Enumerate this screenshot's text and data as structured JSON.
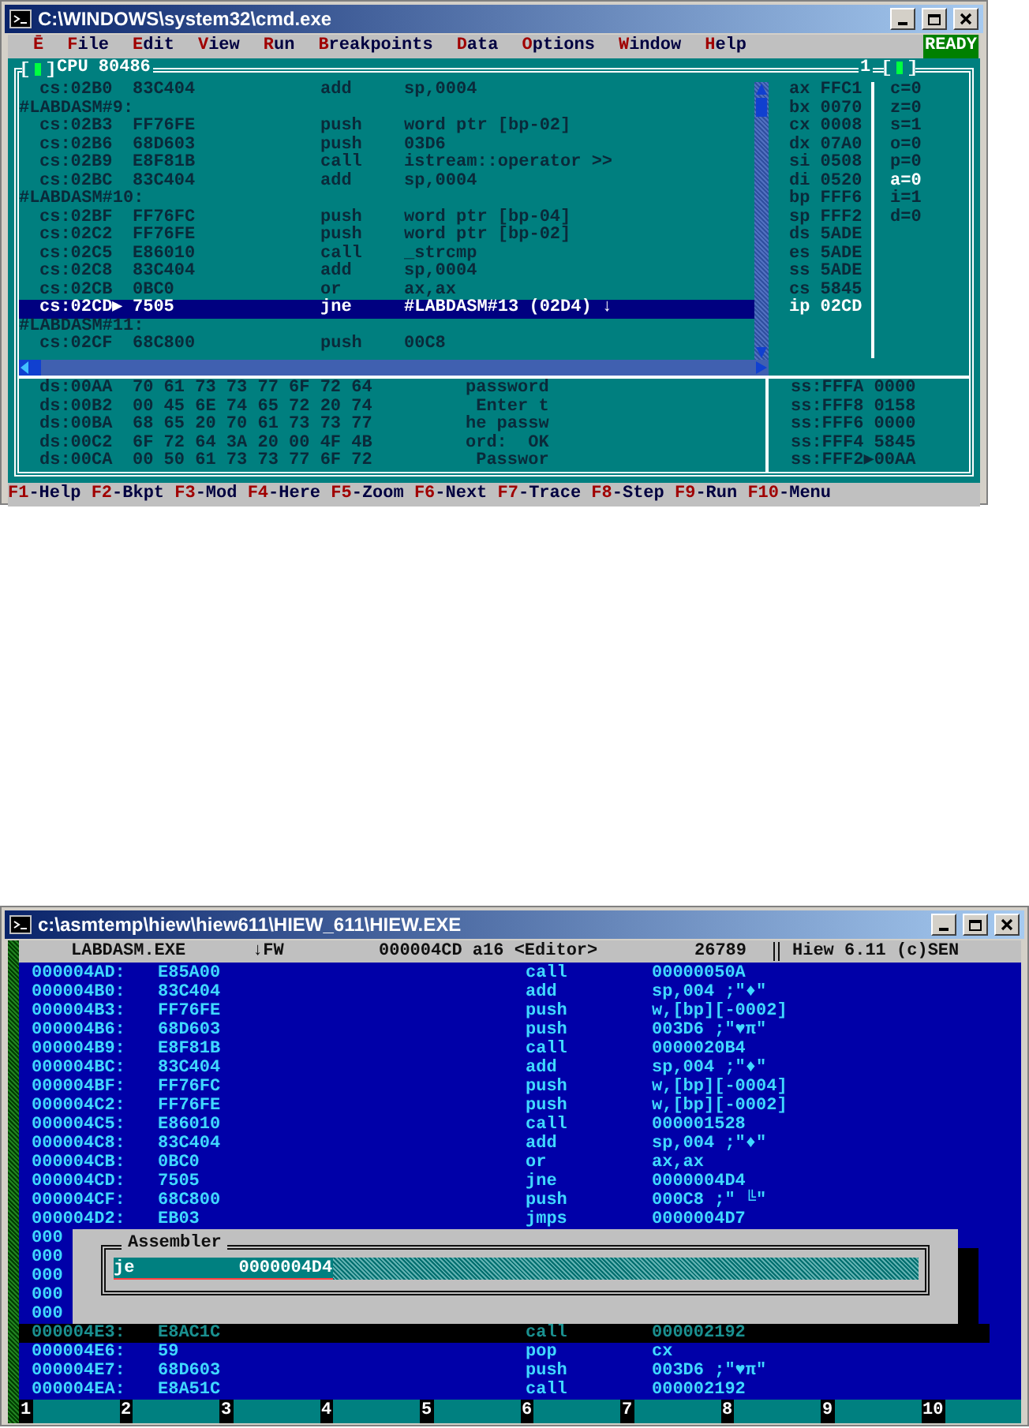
{
  "debugger": {
    "title": "C:\\WINDOWS\\system32\\cmd.exe",
    "menu": [
      {
        "key": "Ē"
      },
      {
        "key": "F",
        "rest": "ile"
      },
      {
        "key": "E",
        "rest": "dit"
      },
      {
        "key": "V",
        "rest": "iew"
      },
      {
        "key": "R",
        "rest": "un"
      },
      {
        "key": "B",
        "rest": "reakpoints"
      },
      {
        "key": "D",
        "rest": "ata"
      },
      {
        "key": "O",
        "rest": "ptions"
      },
      {
        "key": "W",
        "rest": "indow"
      },
      {
        "key": "H",
        "rest": "elp"
      }
    ],
    "status": "READY",
    "pane_title": "CPU 80486",
    "pane_number": "1",
    "code": [
      {
        "kind": "instruction",
        "address": "cs:02B0",
        "bytes": "83C404",
        "mnemonic": "add",
        "operand": "sp,0004",
        "selected": false
      },
      {
        "kind": "label",
        "text": "#LABDASM#9:"
      },
      {
        "kind": "instruction",
        "address": "cs:02B3",
        "bytes": "FF76FE",
        "mnemonic": "push",
        "operand": "word ptr [bp-02]",
        "selected": false
      },
      {
        "kind": "instruction",
        "address": "cs:02B6",
        "bytes": "68D603",
        "mnemonic": "push",
        "operand": "03D6",
        "selected": false
      },
      {
        "kind": "instruction",
        "address": "cs:02B9",
        "bytes": "E8F81B",
        "mnemonic": "call",
        "operand": "istream::operator >>",
        "selected": false
      },
      {
        "kind": "instruction",
        "address": "cs:02BC",
        "bytes": "83C404",
        "mnemonic": "add",
        "operand": "sp,0004",
        "selected": false
      },
      {
        "kind": "label",
        "text": "#LABDASM#10:"
      },
      {
        "kind": "instruction",
        "address": "cs:02BF",
        "bytes": "FF76FC",
        "mnemonic": "push",
        "operand": "word ptr [bp-04]",
        "selected": false
      },
      {
        "kind": "instruction",
        "address": "cs:02C2",
        "bytes": "FF76FE",
        "mnemonic": "push",
        "operand": "word ptr [bp-02]",
        "selected": false
      },
      {
        "kind": "instruction",
        "address": "cs:02C5",
        "bytes": "E86010",
        "mnemonic": "call",
        "operand": "_strcmp",
        "selected": false
      },
      {
        "kind": "instruction",
        "address": "cs:02C8",
        "bytes": "83C404",
        "mnemonic": "add",
        "operand": "sp,0004",
        "selected": false
      },
      {
        "kind": "instruction",
        "address": "cs:02CB",
        "bytes": "0BC0",
        "mnemonic": "or",
        "operand": "ax,ax",
        "selected": false
      },
      {
        "kind": "instruction",
        "address": "cs:02CD",
        "marker": "▶",
        "bytes": "7505",
        "mnemonic": "jne",
        "operand": "#LABDASM#13 (02D4) ↓",
        "selected": true
      },
      {
        "kind": "label",
        "text": "#LABDASM#11:"
      },
      {
        "kind": "instruction",
        "address": "cs:02CF",
        "bytes": "68C800",
        "mnemonic": "push",
        "operand": "00C8",
        "selected": false
      }
    ],
    "registers": [
      {
        "name": "ax",
        "value": "FFC1",
        "changed": false
      },
      {
        "name": "bx",
        "value": "0070",
        "changed": false
      },
      {
        "name": "cx",
        "value": "0008",
        "changed": false
      },
      {
        "name": "dx",
        "value": "07A0",
        "changed": false
      },
      {
        "name": "si",
        "value": "0508",
        "changed": false
      },
      {
        "name": "di",
        "value": "0520",
        "changed": false
      },
      {
        "name": "bp",
        "value": "FFF6",
        "changed": false
      },
      {
        "name": "sp",
        "value": "FFF2",
        "changed": false
      },
      {
        "name": "ds",
        "value": "5ADE",
        "changed": false
      },
      {
        "name": "es",
        "value": "5ADE",
        "changed": false
      },
      {
        "name": "ss",
        "value": "5ADE",
        "changed": false
      },
      {
        "name": "cs",
        "value": "5845",
        "changed": false
      },
      {
        "name": "ip",
        "value": "02CD",
        "changed": true
      }
    ],
    "flags": [
      {
        "text": "c=0",
        "changed": false
      },
      {
        "text": "z=0",
        "changed": false
      },
      {
        "text": "s=1",
        "changed": false
      },
      {
        "text": "o=0",
        "changed": false
      },
      {
        "text": "p=0",
        "changed": false
      },
      {
        "text": "a=0",
        "changed": true
      },
      {
        "text": "i=1",
        "changed": false
      },
      {
        "text": "d=0",
        "changed": false
      }
    ],
    "dump": [
      {
        "address": "ds:00AA",
        "hex": "70 61 73 73 77 6F 72 64",
        "ascii": "password"
      },
      {
        "address": "ds:00B2",
        "hex": "00 45 6E 74 65 72 20 74",
        "ascii": " Enter t"
      },
      {
        "address": "ds:00BA",
        "hex": "68 65 20 70 61 73 73 77",
        "ascii": "he passw"
      },
      {
        "address": "ds:00C2",
        "hex": "6F 72 64 3A 20 00 4F 4B",
        "ascii": "ord:  OK"
      },
      {
        "address": "ds:00CA",
        "hex": "00 50 61 73 73 77 6F 72",
        "ascii": " Passwor"
      }
    ],
    "stack": [
      {
        "address": "ss:FFFA",
        "value": "0000"
      },
      {
        "address": "ss:FFF8",
        "value": "0158"
      },
      {
        "address": "ss:FFF6",
        "value": "0000"
      },
      {
        "address": "ss:FFF4",
        "value": "5845"
      },
      {
        "address": "ss:FFF2",
        "marker": "▶",
        "value": "00AA"
      }
    ],
    "fkeys": [
      {
        "key": "F1",
        "label": "-Help"
      },
      {
        "key": "F2",
        "label": "-Bkpt"
      },
      {
        "key": "F3",
        "label": "-Mod"
      },
      {
        "key": "F4",
        "label": "-Here"
      },
      {
        "key": "F5",
        "label": "-Zoom"
      },
      {
        "key": "F6",
        "label": "-Next"
      },
      {
        "key": "F7",
        "label": "-Trace"
      },
      {
        "key": "F8",
        "label": "-Step"
      },
      {
        "key": "F9",
        "label": "-Run"
      },
      {
        "key": "F10",
        "label": "-Menu"
      }
    ]
  },
  "hiew": {
    "title": "c:\\asmtemp\\hiew\\hiew611\\HIEW_611\\HIEW.EXE",
    "header": {
      "file": "LABDASM.EXE",
      "mode": "↓FW",
      "position": "000004CD a16 <Editor>",
      "size": "26789",
      "version": "Hiew 6.11 (c)SEN"
    },
    "rows": [
      {
        "kind": "row",
        "address": "000004AD:",
        "bytes": "E85A00",
        "mnemonic": "call",
        "operand": "00000050A"
      },
      {
        "kind": "row",
        "address": "000004B0:",
        "bytes": "83C404",
        "mnemonic": "add",
        "operand": "sp,004 ;\"♦\""
      },
      {
        "kind": "row",
        "address": "000004B3:",
        "bytes": "FF76FE",
        "mnemonic": "push",
        "operand": "w,[bp][-0002]"
      },
      {
        "kind": "row",
        "address": "000004B6:",
        "bytes": "68D603",
        "mnemonic": "push",
        "operand": "003D6 ;\"♥π\""
      },
      {
        "kind": "row",
        "address": "000004B9:",
        "bytes": "E8F81B",
        "mnemonic": "call",
        "operand": "0000020B4"
      },
      {
        "kind": "row",
        "address": "000004BC:",
        "bytes": "83C404",
        "mnemonic": "add",
        "operand": "sp,004 ;\"♦\""
      },
      {
        "kind": "row",
        "address": "000004BF:",
        "bytes": "FF76FC",
        "mnemonic": "push",
        "operand": "w,[bp][-0004]"
      },
      {
        "kind": "row",
        "address": "000004C2:",
        "bytes": "FF76FE",
        "mnemonic": "push",
        "operand": "w,[bp][-0002]"
      },
      {
        "kind": "row",
        "address": "000004C5:",
        "bytes": "E86010",
        "mnemonic": "call",
        "operand": "000001528"
      },
      {
        "kind": "row",
        "address": "000004C8:",
        "bytes": "83C404",
        "mnemonic": "add",
        "operand": "sp,004 ;\"♦\""
      },
      {
        "kind": "row",
        "address": "000004CB:",
        "bytes": "0BC0",
        "mnemonic": "or",
        "operand": "ax,ax"
      },
      {
        "kind": "row",
        "address": "000004CD:",
        "bytes": "7505",
        "mnemonic": "jne",
        "operand": "0000004D4"
      },
      {
        "kind": "row",
        "address": "000004CF:",
        "bytes": "68C800",
        "mnemonic": "push",
        "operand": "000C8 ;\" ╚\""
      },
      {
        "kind": "row",
        "address": "000004D2:",
        "bytes": "EB03",
        "mnemonic": "jmps",
        "operand": "0000004D7"
      },
      {
        "kind": "covered",
        "address": "000"
      },
      {
        "kind": "covered",
        "address": "000"
      },
      {
        "kind": "covered",
        "address": "000"
      },
      {
        "kind": "covered",
        "address": "000"
      },
      {
        "kind": "covered",
        "address": "000"
      },
      {
        "kind": "shadowed",
        "address": "000004E3:",
        "bytes": "E8AC1C",
        "mnemonic": "call",
        "operand": "000002192"
      },
      {
        "kind": "row",
        "address": "000004E6:",
        "bytes": "59",
        "mnemonic": "pop",
        "operand": "cx"
      },
      {
        "kind": "row",
        "address": "000004E7:",
        "bytes": "68D603",
        "mnemonic": "push",
        "operand": "003D6 ;\"♥π\""
      },
      {
        "kind": "row",
        "address": "000004EA:",
        "bytes": "E8A51C",
        "mnemonic": "call",
        "operand": "000002192"
      }
    ],
    "dialog": {
      "title": "Assembler",
      "value": "je          0000004D4"
    },
    "fkeys": [
      "1",
      "2",
      "3",
      "4",
      "5",
      "6",
      "7",
      "8",
      "9",
      "10"
    ]
  }
}
